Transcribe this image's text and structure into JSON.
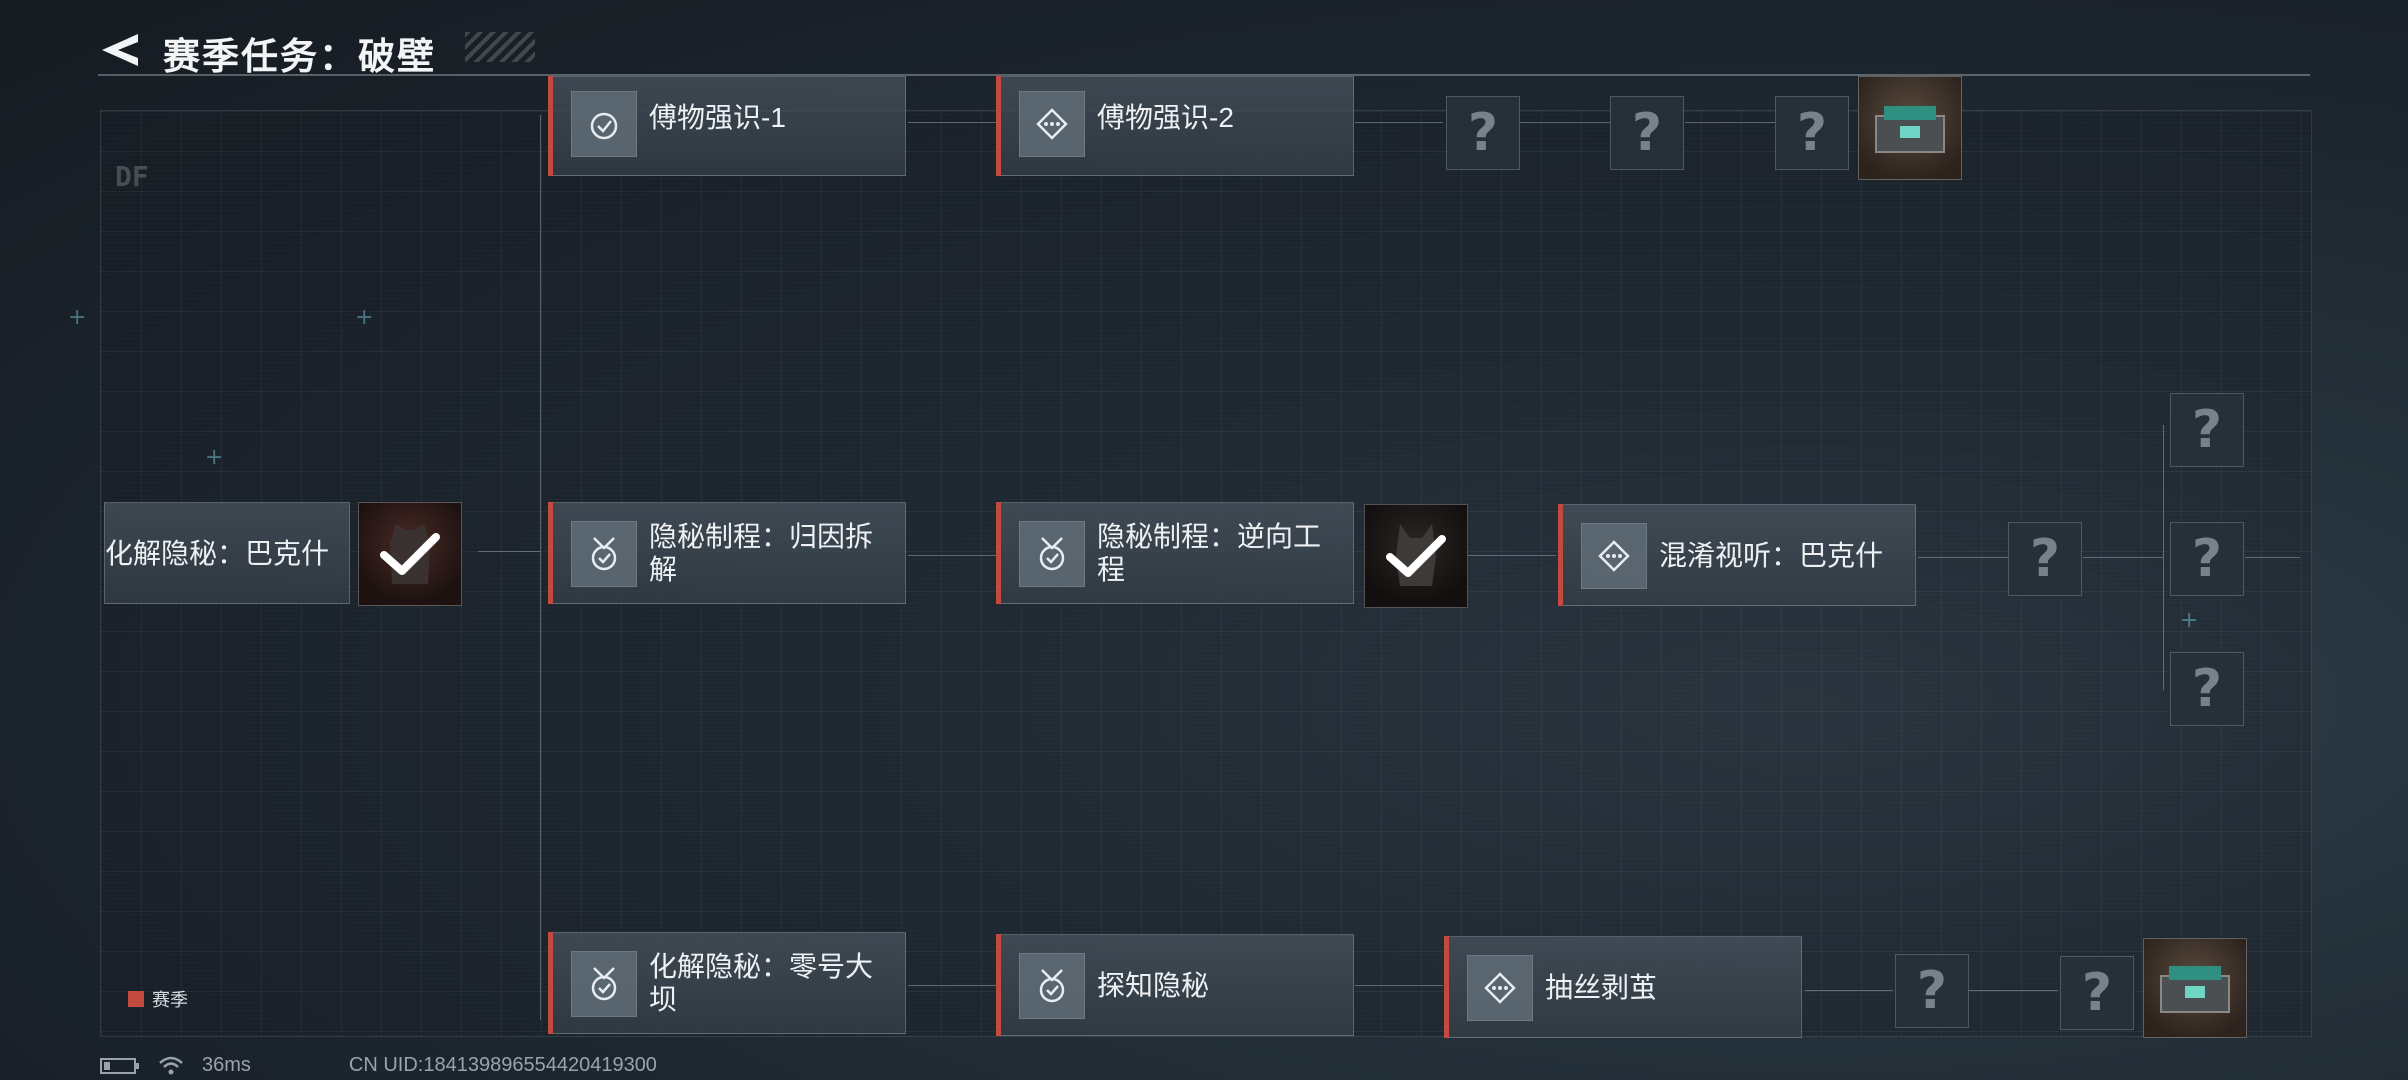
{
  "header": {
    "title": "赛季任务：破壁"
  },
  "tasks": [
    {
      "label": "傅物强识-1"
    },
    {
      "label": "傅物强识-2"
    },
    {
      "label": "化解隐秘：巴克什"
    },
    {
      "label": "隐秘制程：归因拆解"
    },
    {
      "label": "隐秘制程：逆向工程"
    },
    {
      "label": "混淆视听：巴克什"
    },
    {
      "label": "化解隐秘：零号大坝"
    },
    {
      "label": "探知隐秘"
    },
    {
      "label": "抽丝剥茧"
    }
  ],
  "unknown_symbol": "?",
  "legend": {
    "label": "赛季",
    "color": "#c24a3f"
  },
  "status": {
    "latency": "36ms",
    "uid": "CN UID:184139896554420419300"
  },
  "deco": {
    "brand": "DF"
  },
  "colors": {
    "accent": "#c24a3f",
    "background": "#1b232b"
  },
  "icons": [
    "back-arrow-icon",
    "medal-check-icon",
    "diamond-dots-icon",
    "checkmark-icon",
    "battery-icon",
    "wifi-icon",
    "armor-vest-icon",
    "loot-crate-icon"
  ]
}
